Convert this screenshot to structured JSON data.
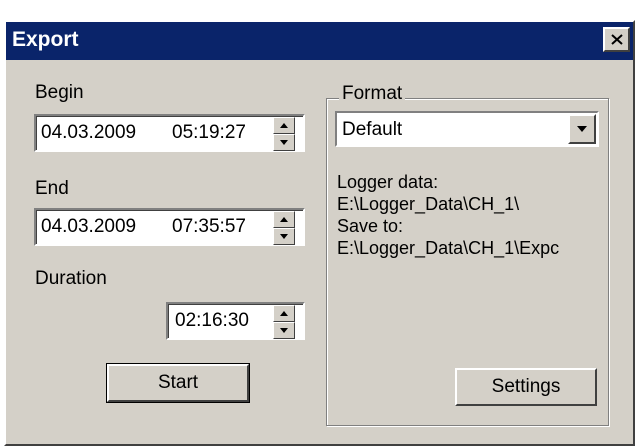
{
  "window": {
    "title": "Export"
  },
  "begin": {
    "label": "Begin",
    "date": "04.03.2009",
    "time": "05:19:27"
  },
  "end": {
    "label": "End",
    "date": "04.03.2009",
    "time": "07:35:57"
  },
  "duration": {
    "label": "Duration",
    "value": "02:16:30"
  },
  "buttons": {
    "start": "Start",
    "settings": "Settings"
  },
  "format": {
    "group_title": "Format",
    "selected": "Default",
    "logger_label": "Logger data:",
    "logger_path": "E:\\Logger_Data\\CH_1\\",
    "save_label": "Save to:",
    "save_path": "E:\\Logger_Data\\CH_1\\Expc"
  },
  "icons": [
    "close-icon",
    "spin-up-icon",
    "spin-down-icon",
    "dropdown-arrow-icon"
  ]
}
